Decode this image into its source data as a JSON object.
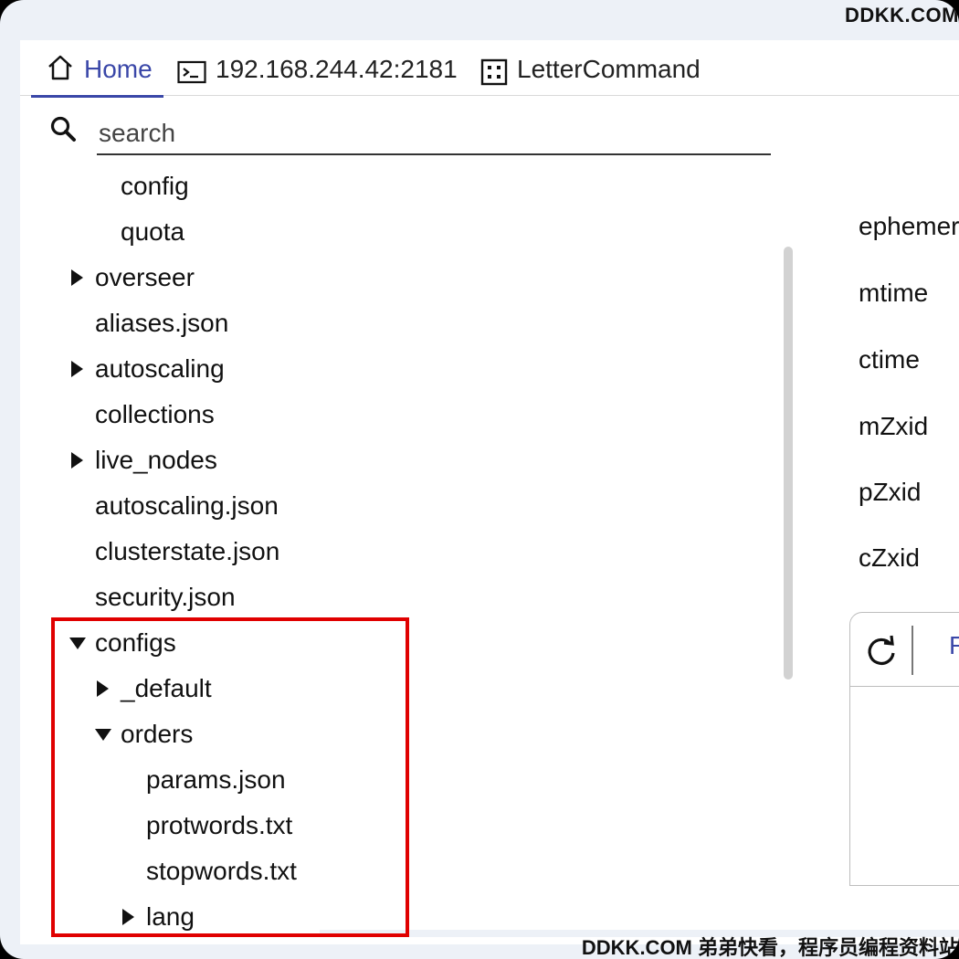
{
  "watermark": {
    "top": "DDKK.COM",
    "bottom": "DDKK.COM 弟弟快看，程序员编程资料站"
  },
  "tabs": [
    {
      "label": "Home",
      "icon": "home-icon",
      "active": true
    },
    {
      "label": "192.168.244.42:2181",
      "icon": "terminal-icon",
      "active": false
    },
    {
      "label": "LetterCommand",
      "icon": "dice-icon",
      "active": false
    }
  ],
  "search": {
    "placeholder": "search",
    "value": ""
  },
  "tree": [
    {
      "label": "config",
      "expander": "none"
    },
    {
      "label": "quota",
      "expander": "none"
    },
    {
      "label": "overseer",
      "expander": "collapsed"
    },
    {
      "label": "aliases.json",
      "expander": "none"
    },
    {
      "label": "autoscaling",
      "expander": "collapsed"
    },
    {
      "label": "collections",
      "expander": "none"
    },
    {
      "label": "live_nodes",
      "expander": "collapsed"
    },
    {
      "label": "autoscaling.json",
      "expander": "none"
    },
    {
      "label": "clusterstate.json",
      "expander": "none"
    },
    {
      "label": "security.json",
      "expander": "none"
    },
    {
      "label": "configs",
      "expander": "expanded"
    },
    {
      "label": "_default",
      "expander": "collapsed"
    },
    {
      "label": "orders",
      "expander": "expanded"
    },
    {
      "label": "params.json",
      "expander": "none"
    },
    {
      "label": "protwords.txt",
      "expander": "none"
    },
    {
      "label": "stopwords.txt",
      "expander": "none"
    },
    {
      "label": "lang",
      "expander": "collapsed"
    }
  ],
  "properties": [
    "ephemera",
    "mtime",
    "ctime",
    "mZxid",
    "pZxid",
    "cZxid"
  ],
  "detail": {
    "toolbar_partial_label": "R",
    "refresh_icon": "refresh-icon"
  },
  "colors": {
    "accent": "#3a47a8",
    "highlight": "#e00000",
    "background": "#edf1f7"
  }
}
